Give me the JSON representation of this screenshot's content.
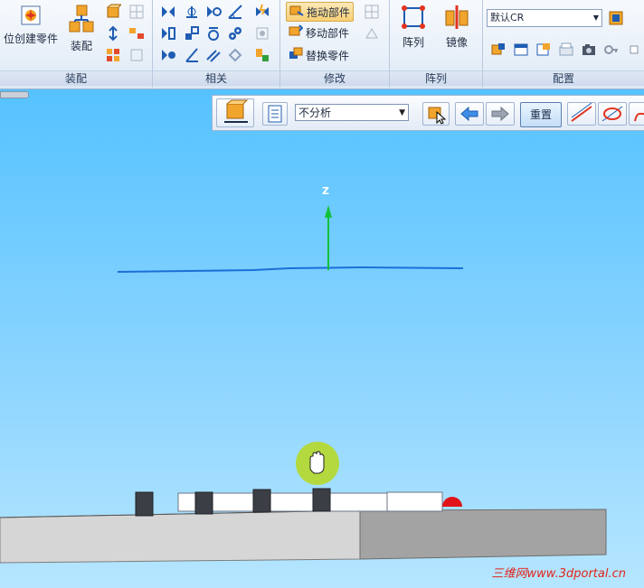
{
  "ribbon": {
    "groups": {
      "assembly": {
        "label": "装配",
        "create_part_in_place": "位创建零件",
        "assemble": "装配"
      },
      "relate": {
        "label": "相关"
      },
      "modify": {
        "label": "修改",
        "drag_component": "拖动部件",
        "move_component": "移动部件",
        "replace_part": "替换零件"
      },
      "pattern": {
        "label": "阵列",
        "pattern": "阵列",
        "mirror": "镜像"
      },
      "configurations": {
        "label": "配置",
        "config_value": "默认CR"
      }
    }
  },
  "analysis_toolbar": {
    "analysis_mode": "不分析",
    "reset_label": "重置"
  },
  "viewport": {
    "triad_z_label": "Z"
  },
  "watermark": "三维网www.3dportal.cn",
  "icons": {
    "drag": "hand-cursor-icon",
    "analysis": "interference-check-icon"
  },
  "colors": {
    "viewport_top": "#55c2ff",
    "highlight": "#f8cf73",
    "watermark": "#e0241b"
  }
}
